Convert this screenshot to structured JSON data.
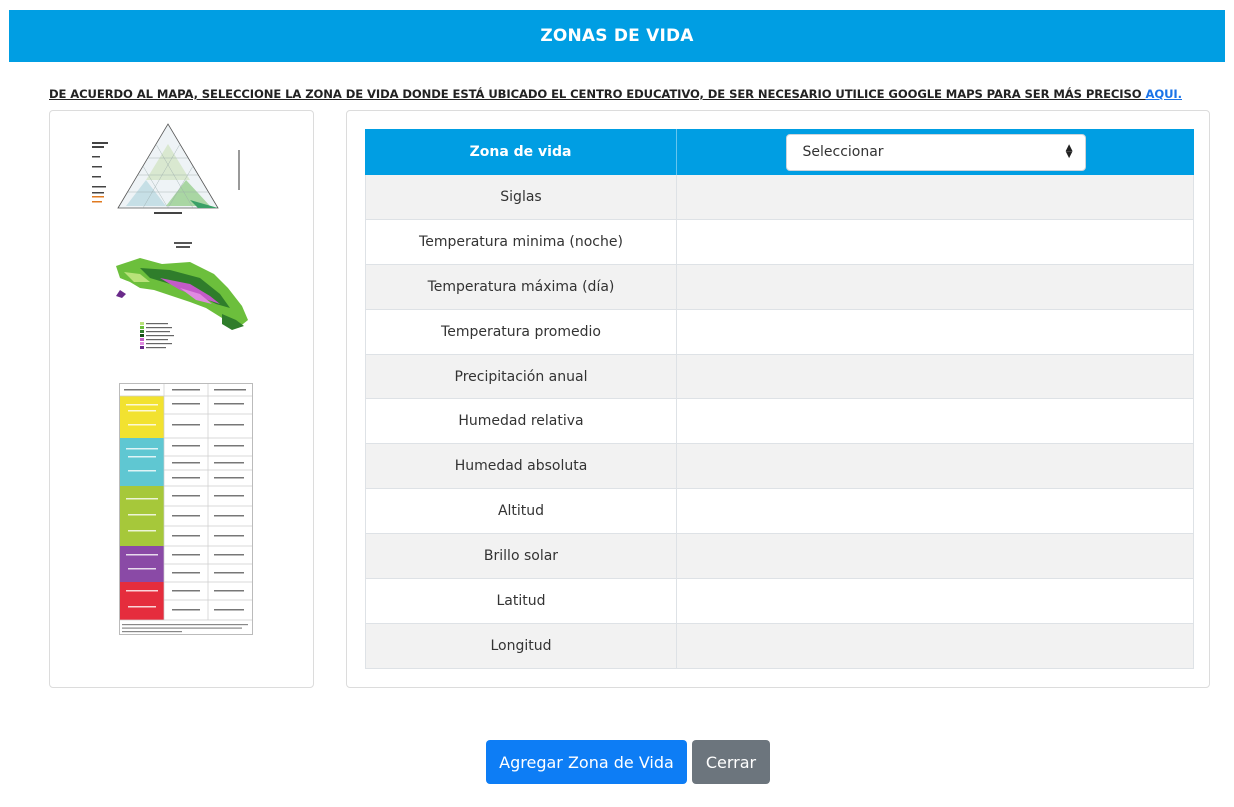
{
  "header": {
    "title": "ZONAS DE VIDA"
  },
  "instruction": {
    "text": "DE ACUERDO AL MAPA, SELECCIONE LA ZONA DE VIDA DONDE ESTÁ UBICADO EL CENTRO EDUCATIVO, DE SER NECESARIO UTILICE GOOGLE MAPS PARA SER MÁS PRECISO ",
    "link": "AQUI."
  },
  "table": {
    "header_label": "Zona de vida",
    "select_value": "Seleccionar",
    "rows": [
      "Siglas",
      "Temperatura minima (noche)",
      "Temperatura máxima (día)",
      "Temperatura promedio",
      "Precipitación anual",
      "Humedad relativa",
      "Humedad absoluta",
      "Altitud",
      "Brillo solar",
      "Latitud",
      "Longitud"
    ]
  },
  "buttons": {
    "add": "Agregar Zona de Vida",
    "close": "Cerrar"
  },
  "colors": {
    "header": "#009ee3",
    "primary_button": "#0d7df5",
    "secondary_button": "#6c757d",
    "striped_row": "#f2f2f2"
  },
  "icons": {
    "select_arrows": "sort-arrows-icon"
  }
}
